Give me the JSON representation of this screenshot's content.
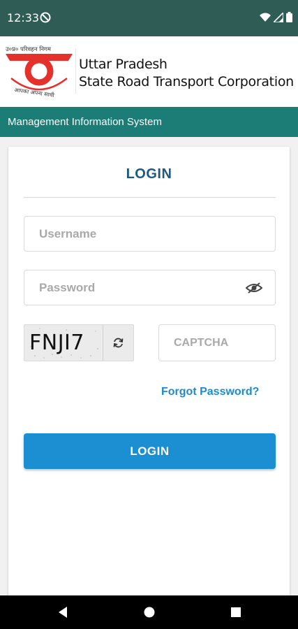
{
  "status_bar": {
    "time": "12:33"
  },
  "header": {
    "logo_hindi_top": "उ०प्र० परिवहन निगम",
    "logo_hindi_bottom": "आपका अपना साथी",
    "org_line1": "Uttar Pradesh",
    "org_line2": "State Road Transport Corporation"
  },
  "subbar": {
    "title": "Management Information System"
  },
  "login_card": {
    "title": "LOGIN",
    "username_placeholder": "Username",
    "password_placeholder": "Password",
    "captcha_text": "FNJI7",
    "captcha_placeholder": "CAPTCHA",
    "forgot_label": "Forgot Password?",
    "login_button_label": "LOGIN"
  },
  "colors": {
    "status_bar": "#2f5d56",
    "subbar": "#1b7d75",
    "title": "#1e5a7e",
    "accent": "#1c8fd3",
    "logo_red": "#e4312b"
  }
}
